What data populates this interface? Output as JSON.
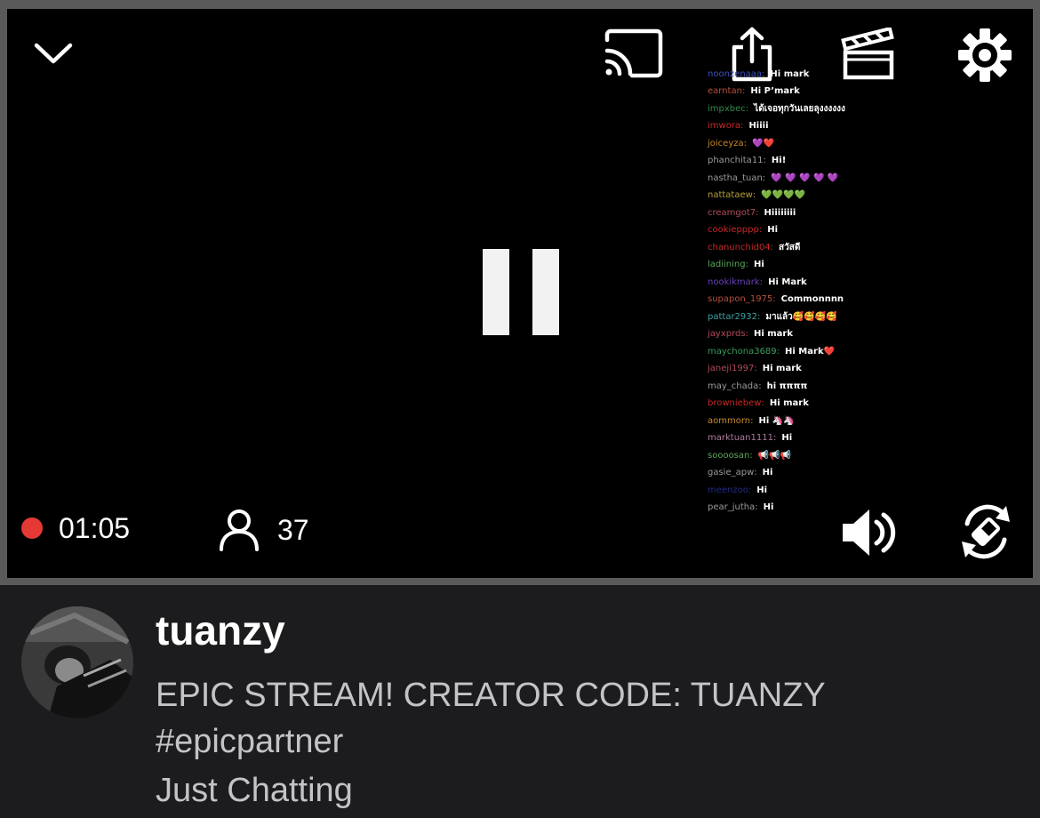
{
  "stream": {
    "elapsed": "01:05",
    "viewer_count": "37",
    "live_color": "#e53935"
  },
  "controls": {
    "top": [
      "chevron-down-icon",
      "cast-icon",
      "share-icon",
      "clip-icon",
      "settings-gear-icon"
    ],
    "center": "pause-icon",
    "bottom": [
      "volume-icon",
      "rotate-icon"
    ]
  },
  "chat": [
    {
      "user": "noonzenaaa",
      "color": "#3b4fbf",
      "msg": "Hi mark"
    },
    {
      "user": "earntan",
      "color": "#b5503a",
      "msg": "Hi P’mark"
    },
    {
      "user": "impxbec",
      "color": "#2f8a4b",
      "msg": "ได้เจอทุกวันเลยลุงงงงงง"
    },
    {
      "user": "imwora",
      "color": "#c62828",
      "msg": "Hiiii"
    },
    {
      "user": "joiceyza",
      "color": "#c78a2a",
      "msg": "💜❤️"
    },
    {
      "user": "phanchita11",
      "color": "#9a9a9a",
      "msg": "Hi!"
    },
    {
      "user": "nastha_tuan",
      "color": "#9a9a9a",
      "msg": "💜 💜 💜 💜 💜"
    },
    {
      "user": "nattataew",
      "color": "#b5a03a",
      "msg": "💚💚💚💚"
    },
    {
      "user": "creamgot7",
      "color": "#b04a5a",
      "msg": "Hiiiiiiii"
    },
    {
      "user": "cookiepppp",
      "color": "#c62828",
      "msg": "Hi"
    },
    {
      "user": "chanunchid04",
      "color": "#c62828",
      "msg": "สวัสดี"
    },
    {
      "user": "ladiining",
      "color": "#5aa85a",
      "msg": "Hi"
    },
    {
      "user": "nookikmark",
      "color": "#6a3fbf",
      "msg": "Hi Mark"
    },
    {
      "user": "supapon_1975",
      "color": "#b5503a",
      "msg": "Commonnnn"
    },
    {
      "user": "pattar2932",
      "color": "#3fa0a0",
      "msg": "มาแล้ว🥰🥰🥰🥰"
    },
    {
      "user": "jayxprds",
      "color": "#b04a5a",
      "msg": "Hi mark"
    },
    {
      "user": "maychona3689",
      "color": "#3a9a5a",
      "msg": "Hi Mark❤️"
    },
    {
      "user": "janeji1997",
      "color": "#b04a5a",
      "msg": "Hi mark"
    },
    {
      "user": "may_chada",
      "color": "#9a9a9a",
      "msg": "hi ππππ"
    },
    {
      "user": "browniebew",
      "color": "#c62828",
      "msg": "Hi mark"
    },
    {
      "user": "aommorn",
      "color": "#c78a2a",
      "msg": "Hi 🦄🦄"
    },
    {
      "user": "marktuan1111",
      "color": "#b07aa0",
      "msg": "Hi"
    },
    {
      "user": "soooosan",
      "color": "#5aa85a",
      "msg": "📢📢📢"
    },
    {
      "user": "gasie_apw",
      "color": "#9a9a9a",
      "msg": "Hi"
    },
    {
      "user": "meenzoo",
      "color": "#1f2a8a",
      "msg": "Hi"
    },
    {
      "user": "pear_jutha",
      "color": "#9a9a9a",
      "msg": "Hi"
    }
  ],
  "channel": {
    "username": "tuanzy",
    "title": "EPIC STREAM! CREATOR CODE: TUANZY #epicpartner",
    "category": "Just Chatting"
  }
}
